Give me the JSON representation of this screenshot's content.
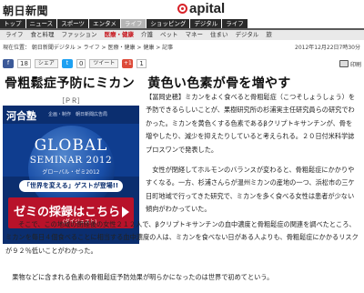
{
  "header": {
    "logo_text": "朝日新聞",
    "section_brand": "apital",
    "brand_color": "#d8232a"
  },
  "nav": {
    "tabs": [
      {
        "label": "トップ",
        "active": false
      },
      {
        "label": "ニュース",
        "active": false
      },
      {
        "label": "スポーツ",
        "active": false
      },
      {
        "label": "エンタメ",
        "active": false
      },
      {
        "label": "ライフ",
        "active": true
      },
      {
        "label": "ショッピング",
        "active": false
      },
      {
        "label": "デジタル",
        "active": false
      },
      {
        "label": "ライフ",
        "active": false
      }
    ]
  },
  "subnav": {
    "items": [
      {
        "label": "ライフ",
        "active": false
      },
      {
        "label": "食と料理",
        "active": false
      },
      {
        "label": "ファッション",
        "active": false
      },
      {
        "label": "医療・健康",
        "active": true
      },
      {
        "label": "介護",
        "active": false
      },
      {
        "label": "ペット",
        "active": false
      },
      {
        "label": "マネー",
        "active": false
      },
      {
        "label": "住まい",
        "active": false
      },
      {
        "label": "デジタル",
        "active": false
      },
      {
        "label": "旅",
        "active": false
      }
    ]
  },
  "breadcrumb": "現在位置： 朝日新聞デジタル > ライフ > 医療・健康 > 健康 > 記事",
  "timestamp": "2012年12月22日7時30分",
  "social": {
    "like_count": "18",
    "tweet_count": "0",
    "plusone_count": "1",
    "share_label": "シェア",
    "tweet_label": "ツイート",
    "print_label": "印刷"
  },
  "article": {
    "headline": "骨粗鬆症予防にミカン　黄色い色素が骨を増やす",
    "paragraphs": [
      "【冨岡史穂】ミカンをよく食べると骨粗鬆症（こつそしょうしょう）を予防できるらしいことが、果樹研究所の杉浦実主任研究員らの研究でわかった。ミカンを黄色くする色素であるβクリプトキサンチンが、骨を増やしたり、減少を抑えたりしていると考えられる。２０日付米科学誌プロスワンで発表した。",
      "女性が閉経してホルモンのバランスが変わると、骨粗鬆症にかかりやすくなる。一方、杉浦さんらが温州ミカンの産地の一つ、浜松市の三ケ日町地域で行ってきた研究で、ミカンを多く食べる女性は患者が少ない傾向がわかっていた。",
      "そこで、この地域の閉経後の女性２１２人で、βクリプトキサンチンの血中濃度と骨粗鬆症の関連を調べたところ、ミカンを毎日４個食べることに相当する血中濃度の人は、ミカンを食べない日がある人よりも、骨粗鬆症にかかるリスクが９２％低いことがわかった。",
      "果物などに含まれる色素の骨粗鬆症予防効果が明らかになったのは世界で初めてという。"
    ]
  },
  "ad": {
    "pr_label": "［ＰＲ］",
    "brand": "河合塾",
    "brand_sub": "企画・制作　朝日新聞広告局",
    "global": "GLOBAL",
    "seminar": "SEMINAR 2012",
    "kana": "グローバル・ゼミ2012",
    "pill": "「世界を変える」ゲストが登場!!",
    "cta_main": "ゼミの採録はこちら",
    "cta_sub": "(ダイジェスト)"
  }
}
